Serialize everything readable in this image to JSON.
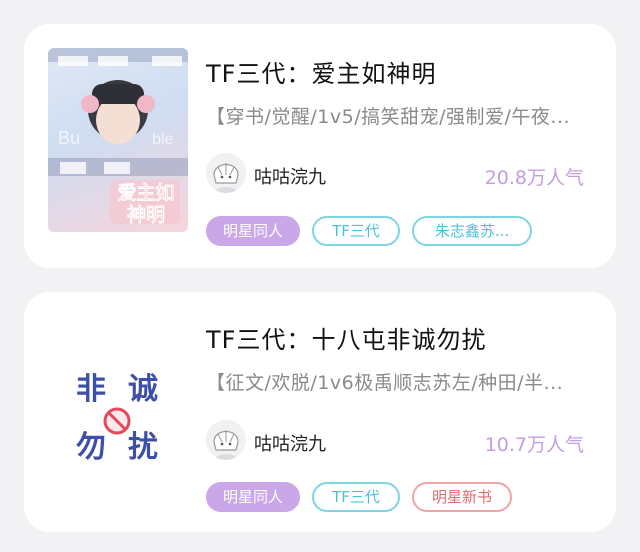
{
  "books": [
    {
      "title": "TF三代：爱主如神明",
      "description": "【穿书/觉醒/1v5/搞笑甜宠/强制爱/午夜...",
      "author": "咕咕浣九",
      "popularity": "20.8万人气",
      "cover_text": "爱主如神明",
      "tags": [
        "明星同人",
        "TF三代",
        "朱志鑫苏..."
      ]
    },
    {
      "title": "TF三代：十八屯非诚勿扰",
      "description": "【征文/欢脱/1v6极禹顺志苏左/种田/半...",
      "author": "咕咕浣九",
      "popularity": "10.7万人气",
      "cover_text": [
        "非",
        "诚",
        "勿",
        "扰"
      ],
      "tags": [
        "明星同人",
        "TF三代",
        "明星新书"
      ]
    }
  ],
  "colors": {
    "tag_purple": "#c9a7e8",
    "tag_teal": "#4cc2d8",
    "tag_red": "#e36a70",
    "popularity": "#c49ee0"
  },
  "icons": [
    "author-avatar-icon",
    "no-sign-icon"
  ]
}
